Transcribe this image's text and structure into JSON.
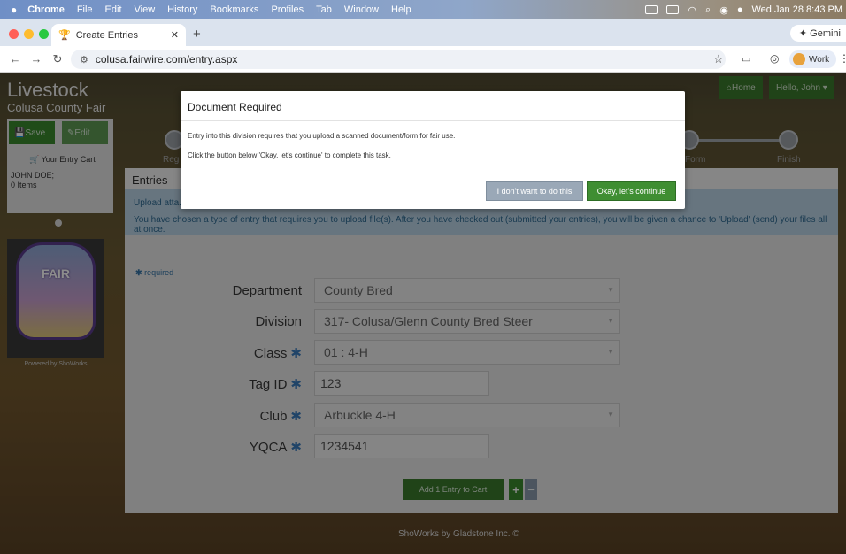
{
  "menubar": {
    "app": "Chrome",
    "items": [
      "File",
      "Edit",
      "View",
      "History",
      "Bookmarks",
      "Profiles",
      "Tab",
      "Window",
      "Help"
    ],
    "datetime": "Wed Jan 28  8:43 PM"
  },
  "browser": {
    "tab_title": "Create Entries",
    "url": "colusa.fairwire.com/entry.aspx",
    "gemini_label": "Gemini",
    "profile_label": "Work"
  },
  "site": {
    "title": "Livestock",
    "subtitle": "Colusa County Fair",
    "home_label": "Home",
    "user_label": "Hello, John"
  },
  "sidebar": {
    "save_label": "Save",
    "edit_label": "Edit",
    "cart_label": "Your Entry Cart",
    "user_name": "JOHN DOE;",
    "items_count": "0 Items",
    "logo_text": "FAIR",
    "powered_by": "Powered by ShoWorks"
  },
  "steps": {
    "first_label": "Reg",
    "form_label": "Form",
    "finish_label": "Finish"
  },
  "entries": {
    "header": "Entries",
    "notice_line1": "Upload atta...",
    "notice_line2": "You have chosen a type of entry that requires you to upload file(s). After you have checked out (submitted your entries), you will be given a chance to 'Upload' (send) your files all at once.",
    "required_note": "required",
    "fields": {
      "department": {
        "label": "Department",
        "value": "County Bred"
      },
      "division": {
        "label": "Division",
        "value": "317- Colusa/Glenn County Bred Steer"
      },
      "class": {
        "label": "Class",
        "value": "01 : 4-H"
      },
      "tag": {
        "label": "Tag ID",
        "value": "123"
      },
      "club": {
        "label": "Club",
        "value": "Arbuckle 4-H"
      },
      "yqca": {
        "label": "YQCA",
        "value": "1234541"
      }
    },
    "add_button": "Add 1 Entry to Cart",
    "plus": "+",
    "minus": "−"
  },
  "footer": {
    "text": "ShoWorks by Gladstone Inc. ©"
  },
  "modal": {
    "title": "Document Required",
    "line1": "Entry into this division requires that you upload a scanned document/form for fair use.",
    "line2": "Click the button below 'Okay, let's continue' to complete this task.",
    "decline_label": "I don't want to do this",
    "accept_label": "Okay, let's continue"
  },
  "colors": {
    "accent_green": "#3f8e32",
    "decline_gray": "#9aa8b7",
    "info_blue": "#bcd6e8"
  }
}
